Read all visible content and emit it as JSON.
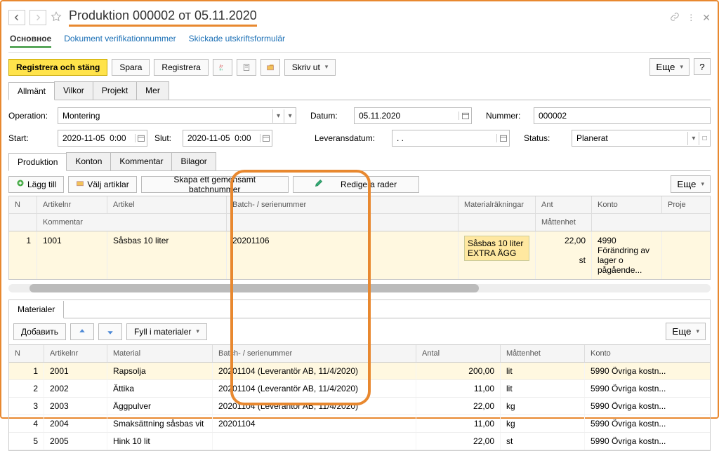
{
  "title": "Produktion 000002 от 05.11.2020",
  "subnav": {
    "active": "Основное",
    "link1": "Dokument verifikationnummer",
    "link2": "Skickade utskriftsformulär"
  },
  "toolbar": {
    "register_close": "Registrera och stäng",
    "save": "Spara",
    "register": "Registrera",
    "print": "Skriv ut",
    "more": "Еще",
    "help": "?"
  },
  "tabs": {
    "t1": "Allmänt",
    "t2": "Vilkor",
    "t3": "Projekt",
    "t4": "Mer"
  },
  "form": {
    "operation_lbl": "Operation:",
    "operation_val": "Montering",
    "date_lbl": "Datum:",
    "date_val": "05.11.2020",
    "number_lbl": "Nummer:",
    "number_val": "000002",
    "start_lbl": "Start:",
    "start_val": "2020-11-05  0:00",
    "end_lbl": "Slut:",
    "end_val": "2020-11-05  0:00",
    "delivdate_lbl": "Leveransdatum:",
    "delivdate_val": ". .",
    "status_lbl": "Status:",
    "status_val": "Planerat"
  },
  "subtabs": {
    "s1": "Produktion",
    "s2": "Konton",
    "s3": "Kommentar",
    "s4": "Bilagor"
  },
  "subtoolbar": {
    "add": "Lägg till",
    "choose": "Välj artiklar",
    "batch": "Skapa ett gemensamt batchnummer",
    "edit": "Redigera rader",
    "more": "Еще"
  },
  "prod_headers": {
    "n": "N",
    "artnr": "Artikelnr",
    "artikel": "Artikel",
    "batch": "Batch- / serienummer",
    "material": "Materialräkningar",
    "ant": "Ant",
    "konto": "Konto",
    "proj": "Proje",
    "comment": "Kommentar",
    "unit": "Måttenhet"
  },
  "prod_row": {
    "n": "1",
    "artnr": "1001",
    "artikel": "Såsbas 10 liter",
    "batch": "20201106",
    "material": "Såsbas 10 liter EXTRA ÄGG",
    "ant": "22,00",
    "unit": "st",
    "konto": "4990 Förändring av lager o pågående..."
  },
  "mat_tab": "Materialer",
  "mat_toolbar": {
    "add": "Добавить",
    "fill": "Fyll i materialer",
    "more": "Еще"
  },
  "mat_headers": {
    "n": "N",
    "artnr": "Artikelnr",
    "material": "Material",
    "batch": "Batch- / serienummer",
    "antal": "Antal",
    "unit": "Måttenhet",
    "konto": "Konto"
  },
  "mat_rows": [
    {
      "n": "1",
      "artnr": "2001",
      "material": "Rapsolja",
      "batch": "20201104 (Leverantör AB, 11/4/2020)",
      "antal": "200,00",
      "unit": "lit",
      "konto": "5990 Övriga kostn..."
    },
    {
      "n": "2",
      "artnr": "2002",
      "material": "Ättika",
      "batch": "20201104 (Leverantör AB, 11/4/2020)",
      "antal": "11,00",
      "unit": "lit",
      "konto": "5990 Övriga kostn..."
    },
    {
      "n": "3",
      "artnr": "2003",
      "material": "Äggpulver",
      "batch": "20201104 (Leverantör AB, 11/4/2020)",
      "antal": "22,00",
      "unit": "kg",
      "konto": "5990 Övriga kostn..."
    },
    {
      "n": "4",
      "artnr": "2004",
      "material": "Smaksättning såsbas vit",
      "batch": "20201104",
      "antal": "11,00",
      "unit": "kg",
      "konto": "5990 Övriga kostn..."
    },
    {
      "n": "5",
      "artnr": "2005",
      "material": "Hink 10 lit",
      "batch": "",
      "antal": "22,00",
      "unit": "st",
      "konto": "5990 Övriga kostn..."
    }
  ]
}
